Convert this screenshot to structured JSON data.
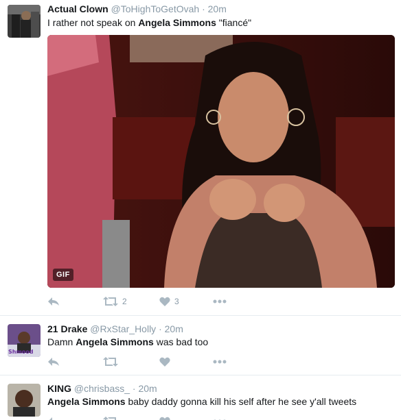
{
  "tweets": [
    {
      "name": "Actual Clown",
      "handle": "@ToHighToGetOvah",
      "separator": "·",
      "time": "20m",
      "text_before": "I rather not speak on ",
      "text_bold": "Angela Simmons",
      "text_after": " \"fiancé\"",
      "media_badge": "GIF",
      "retweets": "2",
      "likes": "3"
    },
    {
      "name": "21 Drake",
      "handle": "@RxStar_Holly",
      "separator": "·",
      "time": "20m",
      "avatar_text": "Shmood",
      "text_before": "Damn ",
      "text_bold": "Angela Simmons",
      "text_after": " was bad too"
    },
    {
      "name": "KING",
      "handle": "@chrisbass_",
      "separator": "·",
      "time": "20m",
      "text_before": "",
      "text_bold": "Angela Simmons",
      "text_after": " baby daddy gonna kill his self after he see y'all tweets"
    }
  ],
  "icons": {
    "reply": "reply-icon",
    "retweet": "retweet-icon",
    "like": "heart-icon",
    "more": "more-icon"
  },
  "colors": {
    "action_gray": "#aab8c2",
    "secondary_text": "#8899a6",
    "divider": "#e6ecf0"
  }
}
